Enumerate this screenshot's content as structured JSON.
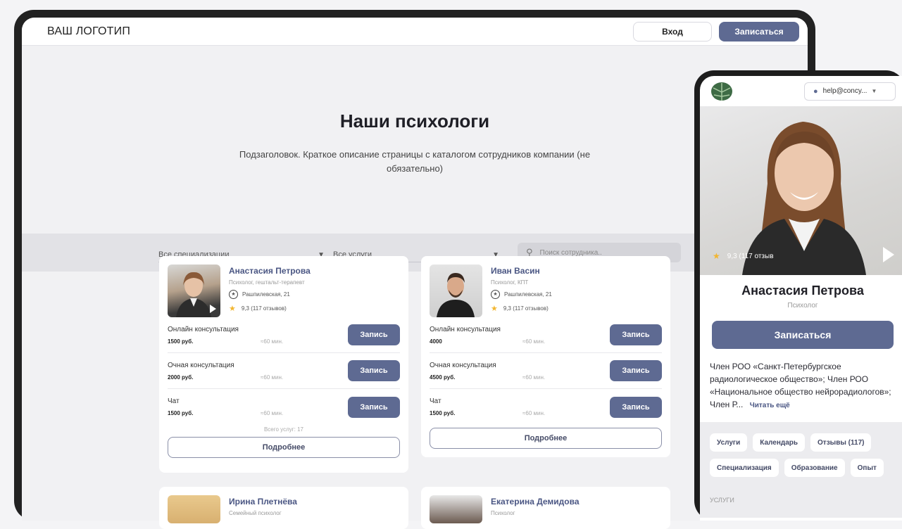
{
  "desktop": {
    "logo": "ВАШ ЛОГОТИП",
    "login_label": "Вход",
    "signup_label": "Записаться",
    "title": "Наши психологи",
    "subtitle": "Подзаголовок. Краткое описание страницы с каталогом сотрудников компании (не обязательно)",
    "filters": {
      "specializations": "Все специализации",
      "services": "Все услуги",
      "search_placeholder": "Поиск сотрудника.."
    },
    "cards": [
      {
        "name": "Анастасия Петрова",
        "role": "Психолог, гештальт-терапевт",
        "address": "Рашпилевская, 21",
        "rating": "9,3 (117 отзывов)",
        "services": [
          {
            "name": "Онлайн консультация",
            "price": "1500 руб.",
            "duration": "≈60 мин.",
            "button": "Запись"
          },
          {
            "name": "Очная консультация",
            "price": "2000 руб.",
            "duration": "≈60 мин.",
            "button": "Запись"
          },
          {
            "name": "Чат",
            "price": "1500 руб.",
            "duration": "≈60 мин.",
            "button": "Запись"
          }
        ],
        "total": "Всего услуг: 17",
        "more": "Подробнее"
      },
      {
        "name": "Иван Васин",
        "role": "Психолог, КПТ",
        "address": "Рашпилевская, 21",
        "rating": "9,3 (117 отзывов)",
        "services": [
          {
            "name": "Онлайн консультация",
            "price": "4000",
            "duration": "≈60 мин.",
            "button": "Запись"
          },
          {
            "name": "Очная консультация",
            "price": "4500 руб.",
            "duration": "≈60 мин.",
            "button": "Запись"
          },
          {
            "name": "Чат",
            "price": "1500 руб.",
            "duration": "≈60 мин.",
            "button": "Запись"
          }
        ],
        "more": "Подробнее"
      },
      {
        "name": "Ирина Плетнёва",
        "role": "Семейный психолог"
      },
      {
        "name": "Екатерина Демидова",
        "role": "Психолог"
      }
    ]
  },
  "mobile": {
    "user": "help@concy...",
    "rating": "9,3 (117 отзыв",
    "name": "Анастасия Петрова",
    "role": "Психолог",
    "book_label": "Записаться",
    "bio": "Член РОО «Санкт-Петербургское радиологическое общество»; Член РОО «Национальное общество нейрорадиологов»; Член Р...",
    "read_more": "Читать ещё",
    "tabs": [
      "Услуги",
      "Календарь",
      "Отзывы (117)",
      "Специализация",
      "Образование",
      "Опыт"
    ],
    "section": "УСЛУГИ"
  },
  "colors": {
    "accent": "#5e6a92",
    "star": "#f2b630"
  }
}
